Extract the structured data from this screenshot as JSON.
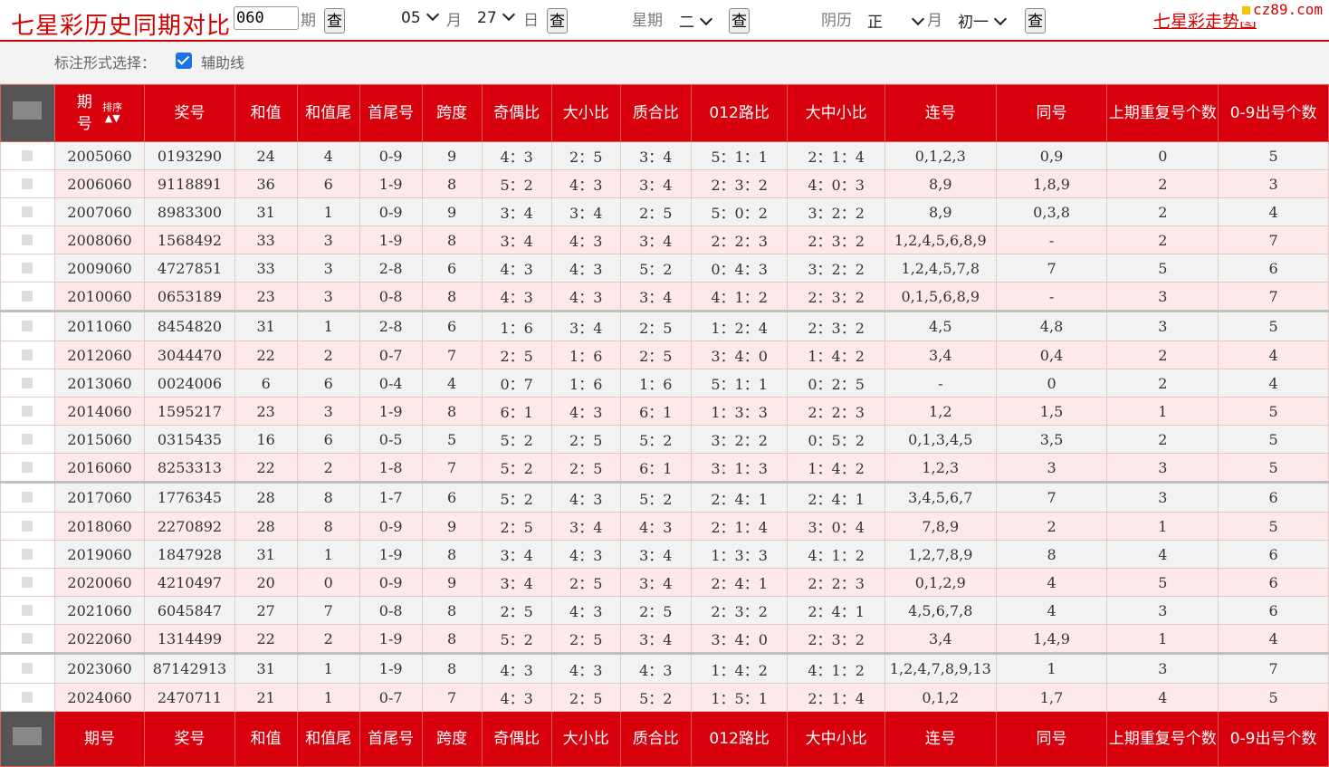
{
  "header": {
    "title": "七星彩历史同期对比",
    "period_value": "060",
    "period_label": "期",
    "query": "查",
    "month_value": "05",
    "month_label": "月",
    "day_value": "27",
    "day_label": "日",
    "week_label": "星期",
    "week_value": "二",
    "lunar_label": "阴历",
    "lunar_month_value": "正",
    "lunar_month_label": "月",
    "lunar_day_value": "初一",
    "trend_link": "七星彩走势图",
    "logo_text": "cz89.com"
  },
  "options": {
    "label": "标注形式选择：",
    "checkbox_label": "辅助线",
    "checked": true
  },
  "table": {
    "columns": [
      "期号",
      "奖号",
      "和值",
      "和值尾",
      "首尾号",
      "跨度",
      "奇偶比",
      "大小比",
      "质合比",
      "012路比",
      "大中小比",
      "连号",
      "同号",
      "上期重复号个数",
      "0-9出号个数"
    ],
    "header_first": {
      "top": "期",
      "bottom": "号",
      "sort": "排序"
    },
    "rows": [
      [
        "2005060",
        "0193290",
        "24",
        "4",
        "0-9",
        "9",
        "4：3",
        "2：5",
        "3：4",
        "5：1：1",
        "2：1：4",
        "0,1,2,3",
        "0,9",
        "0",
        "5"
      ],
      [
        "2006060",
        "9118891",
        "36",
        "6",
        "1-9",
        "8",
        "5：2",
        "4：3",
        "3：4",
        "2：3：2",
        "4：0：3",
        "8,9",
        "1,8,9",
        "2",
        "3"
      ],
      [
        "2007060",
        "8983300",
        "31",
        "1",
        "0-9",
        "9",
        "3：4",
        "3：4",
        "2：5",
        "5：0：2",
        "3：2：2",
        "8,9",
        "0,3,8",
        "2",
        "4"
      ],
      [
        "2008060",
        "1568492",
        "33",
        "3",
        "1-9",
        "8",
        "3：4",
        "4：3",
        "3：4",
        "2：2：3",
        "2：3：2",
        "1,2,4,5,6,8,9",
        "-",
        "2",
        "7"
      ],
      [
        "2009060",
        "4727851",
        "33",
        "3",
        "2-8",
        "6",
        "4：3",
        "4：3",
        "5：2",
        "0：4：3",
        "3：2：2",
        "1,2,4,5,7,8",
        "7",
        "5",
        "6"
      ],
      [
        "2010060",
        "0653189",
        "23",
        "3",
        "0-8",
        "8",
        "4：3",
        "4：3",
        "3：4",
        "4：1：2",
        "2：3：2",
        "0,1,5,6,8,9",
        "-",
        "3",
        "7"
      ],
      [
        "2011060",
        "8454820",
        "31",
        "1",
        "2-8",
        "6",
        "1：6",
        "3：4",
        "2：5",
        "1：2：4",
        "2：3：2",
        "4,5",
        "4,8",
        "3",
        "5"
      ],
      [
        "2012060",
        "3044470",
        "22",
        "2",
        "0-7",
        "7",
        "2：5",
        "1：6",
        "2：5",
        "3：4：0",
        "1：4：2",
        "3,4",
        "0,4",
        "2",
        "4"
      ],
      [
        "2013060",
        "0024006",
        "6",
        "6",
        "0-4",
        "4",
        "0：7",
        "1：6",
        "1：6",
        "5：1：1",
        "0：2：5",
        "-",
        "0",
        "2",
        "4"
      ],
      [
        "2014060",
        "1595217",
        "23",
        "3",
        "1-9",
        "8",
        "6：1",
        "4：3",
        "6：1",
        "1：3：3",
        "2：2：3",
        "1,2",
        "1,5",
        "1",
        "5"
      ],
      [
        "2015060",
        "0315435",
        "16",
        "6",
        "0-5",
        "5",
        "5：2",
        "2：5",
        "5：2",
        "3：2：2",
        "0：5：2",
        "0,1,3,4,5",
        "3,5",
        "2",
        "5"
      ],
      [
        "2016060",
        "8253313",
        "22",
        "2",
        "1-8",
        "7",
        "5：2",
        "2：5",
        "6：1",
        "3：1：3",
        "1：4：2",
        "1,2,3",
        "3",
        "3",
        "5"
      ],
      [
        "2017060",
        "1776345",
        "28",
        "8",
        "1-7",
        "6",
        "5：2",
        "4：3",
        "5：2",
        "2：4：1",
        "2：4：1",
        "3,4,5,6,7",
        "7",
        "3",
        "6"
      ],
      [
        "2018060",
        "2270892",
        "28",
        "8",
        "0-9",
        "9",
        "2：5",
        "3：4",
        "4：3",
        "2：1：4",
        "3：0：4",
        "7,8,9",
        "2",
        "1",
        "5"
      ],
      [
        "2019060",
        "1847928",
        "31",
        "1",
        "1-9",
        "8",
        "3：4",
        "4：3",
        "3：4",
        "1：3：3",
        "4：1：2",
        "1,2,7,8,9",
        "8",
        "4",
        "6"
      ],
      [
        "2020060",
        "4210497",
        "20",
        "0",
        "0-9",
        "9",
        "3：4",
        "2：5",
        "3：4",
        "2：4：1",
        "2：2：3",
        "0,1,2,9",
        "4",
        "5",
        "6"
      ],
      [
        "2021060",
        "6045847",
        "27",
        "7",
        "0-8",
        "8",
        "2：5",
        "4：3",
        "2：5",
        "2：3：2",
        "2：4：1",
        "4,5,6,7,8",
        "4",
        "3",
        "6"
      ],
      [
        "2022060",
        "1314499",
        "22",
        "2",
        "1-9",
        "8",
        "5：2",
        "2：5",
        "3：4",
        "3：4：0",
        "2：3：2",
        "3,4",
        "1,4,9",
        "1",
        "4"
      ],
      [
        "2023060",
        "87142913",
        "31",
        "1",
        "1-9",
        "8",
        "4：3",
        "4：3",
        "4：3",
        "1：4：2",
        "4：1：2",
        "1,2,4,7,8,9,13",
        "1",
        "3",
        "7"
      ],
      [
        "2024060",
        "2470711",
        "21",
        "1",
        "0-7",
        "7",
        "4：3",
        "2：5",
        "5：2",
        "1：5：1",
        "2：1：4",
        "0,1,2",
        "1,7",
        "4",
        "5"
      ]
    ],
    "separator_before": [
      6,
      12,
      18
    ]
  }
}
